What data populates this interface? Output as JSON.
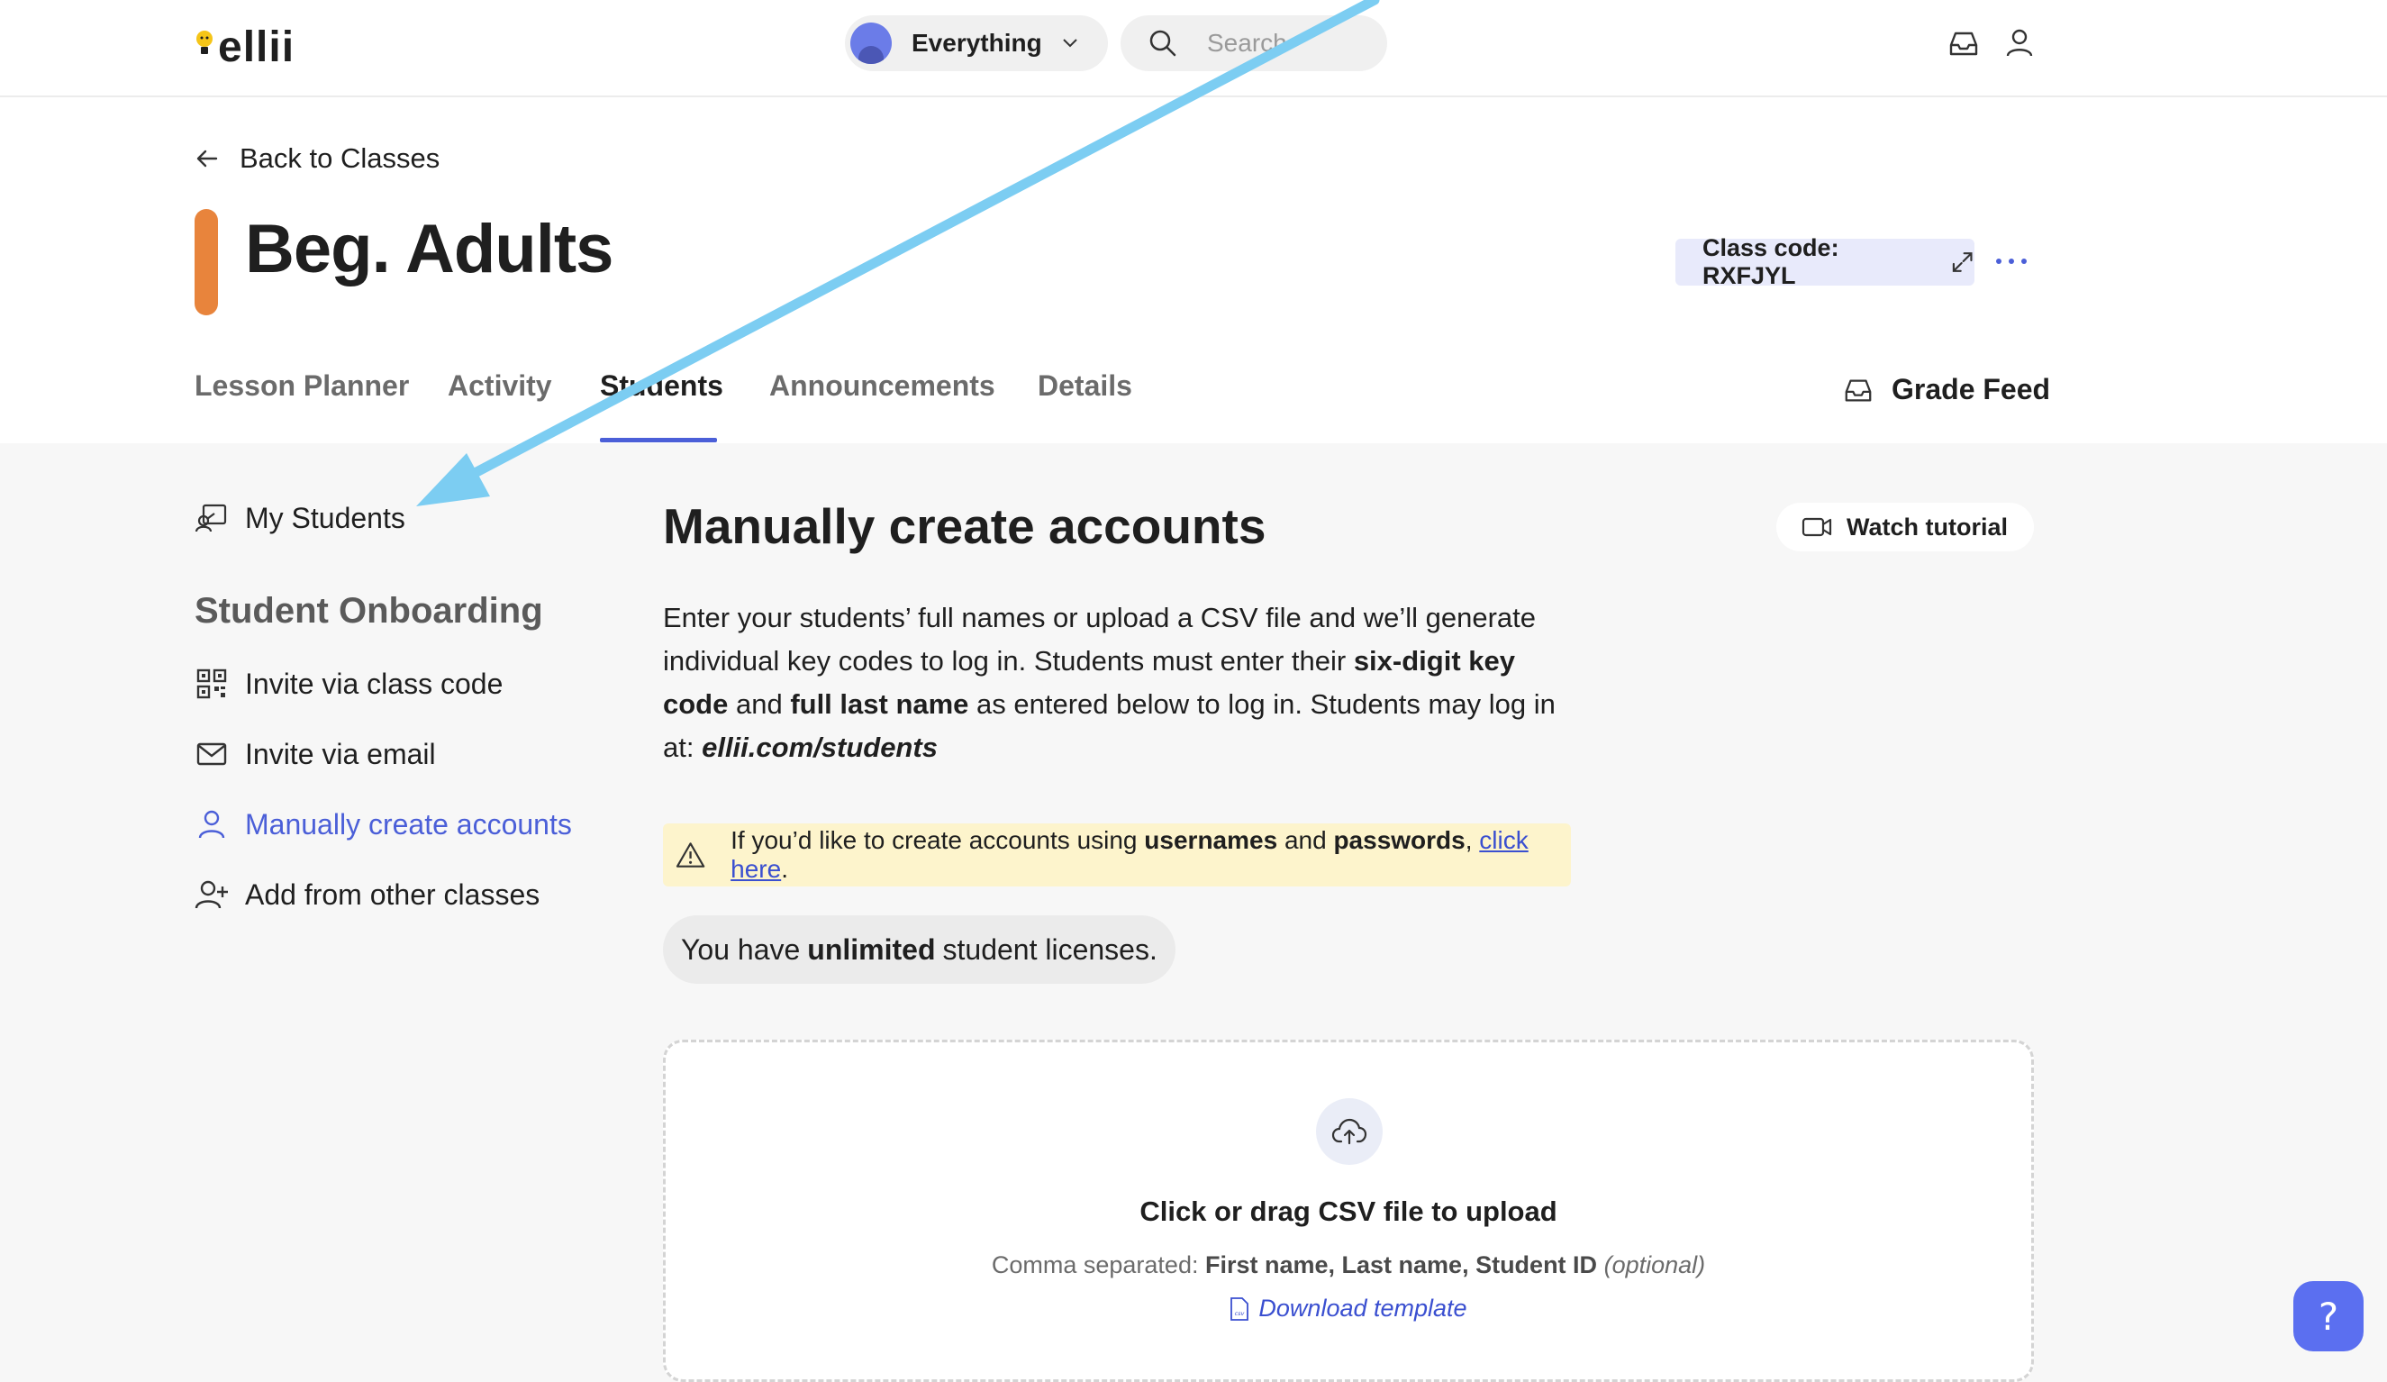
{
  "header": {
    "logo_text": "ellii",
    "workspace": "Everything",
    "search_placeholder": "Search"
  },
  "class": {
    "back_label": "Back to Classes",
    "title": "Beg. Adults",
    "color": "#e8843c",
    "code_label": "Class code: RXFJYL"
  },
  "tabs": [
    {
      "label": "Lesson Planner",
      "active": false
    },
    {
      "label": "Activity",
      "active": false
    },
    {
      "label": "Students",
      "active": true
    },
    {
      "label": "Announcements",
      "active": false
    },
    {
      "label": "Details",
      "active": false
    }
  ],
  "grade_feed": "Grade Feed",
  "sidebar": {
    "my_students": "My Students",
    "heading": "Student Onboarding",
    "items": [
      {
        "label": "Invite via class code",
        "icon": "qr-code-icon",
        "active": false
      },
      {
        "label": "Invite via email",
        "icon": "envelope-icon",
        "active": false
      },
      {
        "label": "Manually create accounts",
        "icon": "user-icon",
        "active": true
      },
      {
        "label": "Add from other classes",
        "icon": "user-plus-icon",
        "active": false
      }
    ]
  },
  "main": {
    "title": "Manually create accounts",
    "tutorial_label": "Watch tutorial",
    "desc": {
      "p1": "Enter your students’ full names or upload a CSV file and we’ll generate individual key codes to log in. Students must enter their ",
      "b1": "six-digit key code",
      "p2": " and ",
      "b2": "full last name",
      "p3": " as entered below to log in. Students may log in at: ",
      "url": "ellii.com/students"
    },
    "warning": {
      "p1": "If you’d like to create accounts using ",
      "b1": "usernames",
      "p2": " and ",
      "b2": "passwords",
      "p3": ", ",
      "link": "click here",
      "p4": "."
    },
    "license": {
      "p1": "You have ",
      "b1": "unlimited",
      "p2": " student licenses."
    },
    "upload": {
      "title": "Click or drag CSV file to upload",
      "sub_prefix": "Comma separated: ",
      "sub_fields": "First name, Last name, Student ID",
      "sub_optional": "(optional)",
      "download": "Download template"
    }
  },
  "help_label": "?",
  "colors": {
    "accent": "#4b5fd8",
    "annotation_arrow": "#7ccdf2",
    "warning_bg": "#fdf4cc"
  }
}
